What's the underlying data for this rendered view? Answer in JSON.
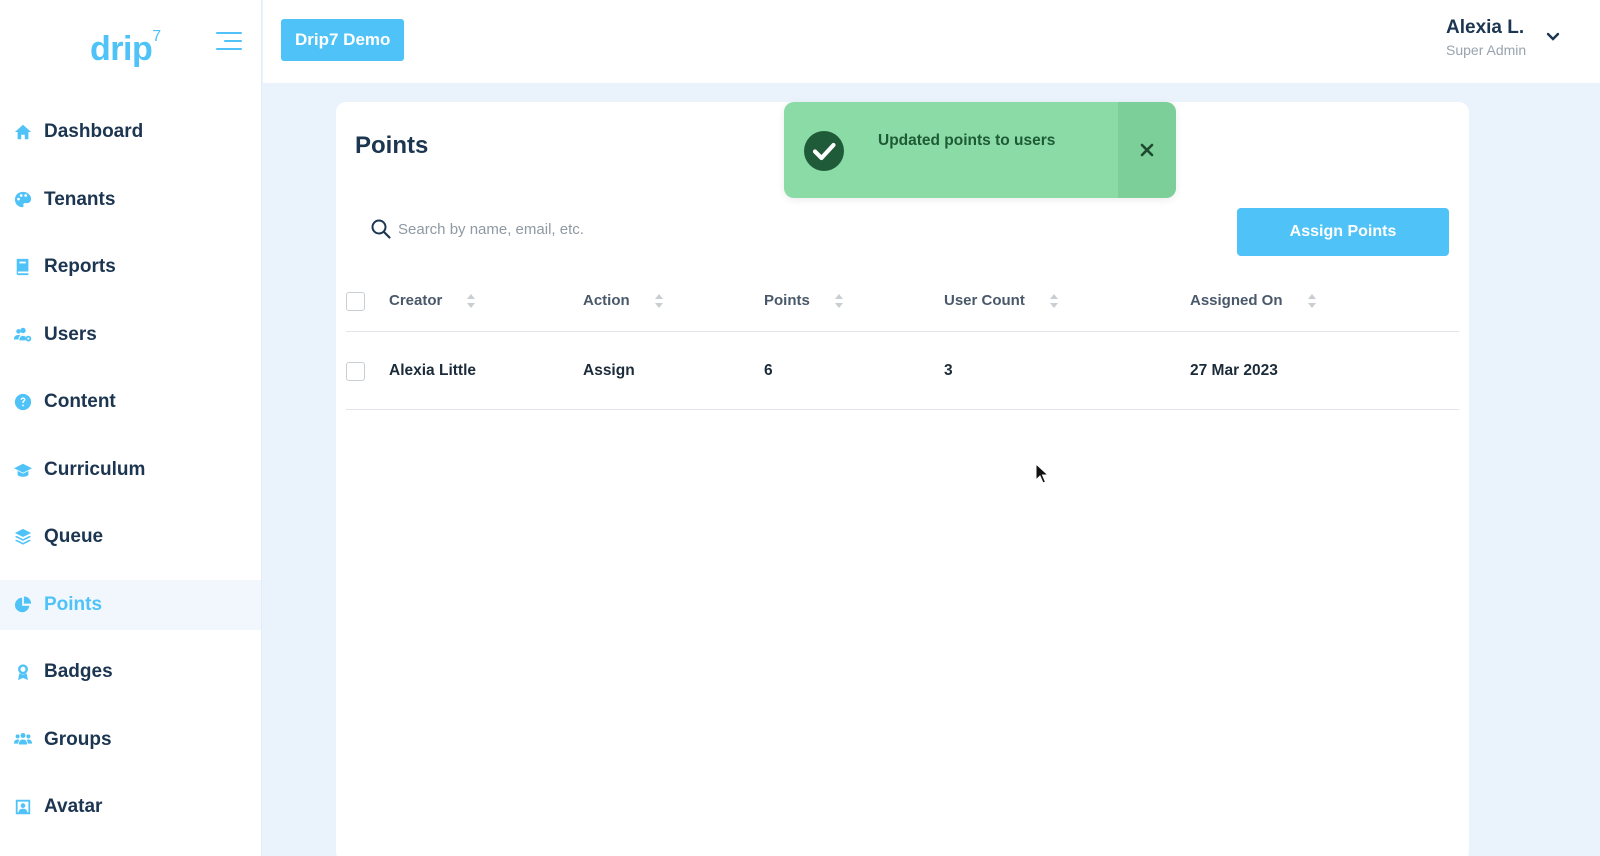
{
  "brand": {
    "logo_text": "drip",
    "logo_sup": "7"
  },
  "header": {
    "tenant_button": "Drip7 Demo",
    "user_name": "Alexia L.",
    "user_role": "Super Admin"
  },
  "sidebar": {
    "items": [
      {
        "label": "Dashboard",
        "icon": "home-icon"
      },
      {
        "label": "Tenants",
        "icon": "palette-icon"
      },
      {
        "label": "Reports",
        "icon": "book-icon"
      },
      {
        "label": "Users",
        "icon": "users-gear-icon"
      },
      {
        "label": "Content",
        "icon": "question-circle-icon"
      },
      {
        "label": "Curriculum",
        "icon": "graduation-cap-icon"
      },
      {
        "label": "Queue",
        "icon": "layers-icon"
      },
      {
        "label": "Points",
        "icon": "pie-chart-icon",
        "active": true
      },
      {
        "label": "Badges",
        "icon": "award-icon"
      },
      {
        "label": "Groups",
        "icon": "group-icon"
      },
      {
        "label": "Avatar",
        "icon": "portrait-icon"
      }
    ]
  },
  "main": {
    "title": "Points",
    "search_placeholder": "Search by name, email, etc.",
    "assign_button": "Assign Points",
    "columns": [
      "Creator",
      "Action",
      "Points",
      "User Count",
      "Assigned On"
    ],
    "rows": [
      [
        "Alexia Little",
        "Assign",
        "6",
        "3",
        "27 Mar 2023"
      ]
    ]
  },
  "toast": {
    "message": "Updated points to users"
  },
  "colors": {
    "accent": "#4fc3f7",
    "text_dark": "#1c3550",
    "toast_bg": "#8adba6",
    "toast_check": "#1f5b38"
  }
}
